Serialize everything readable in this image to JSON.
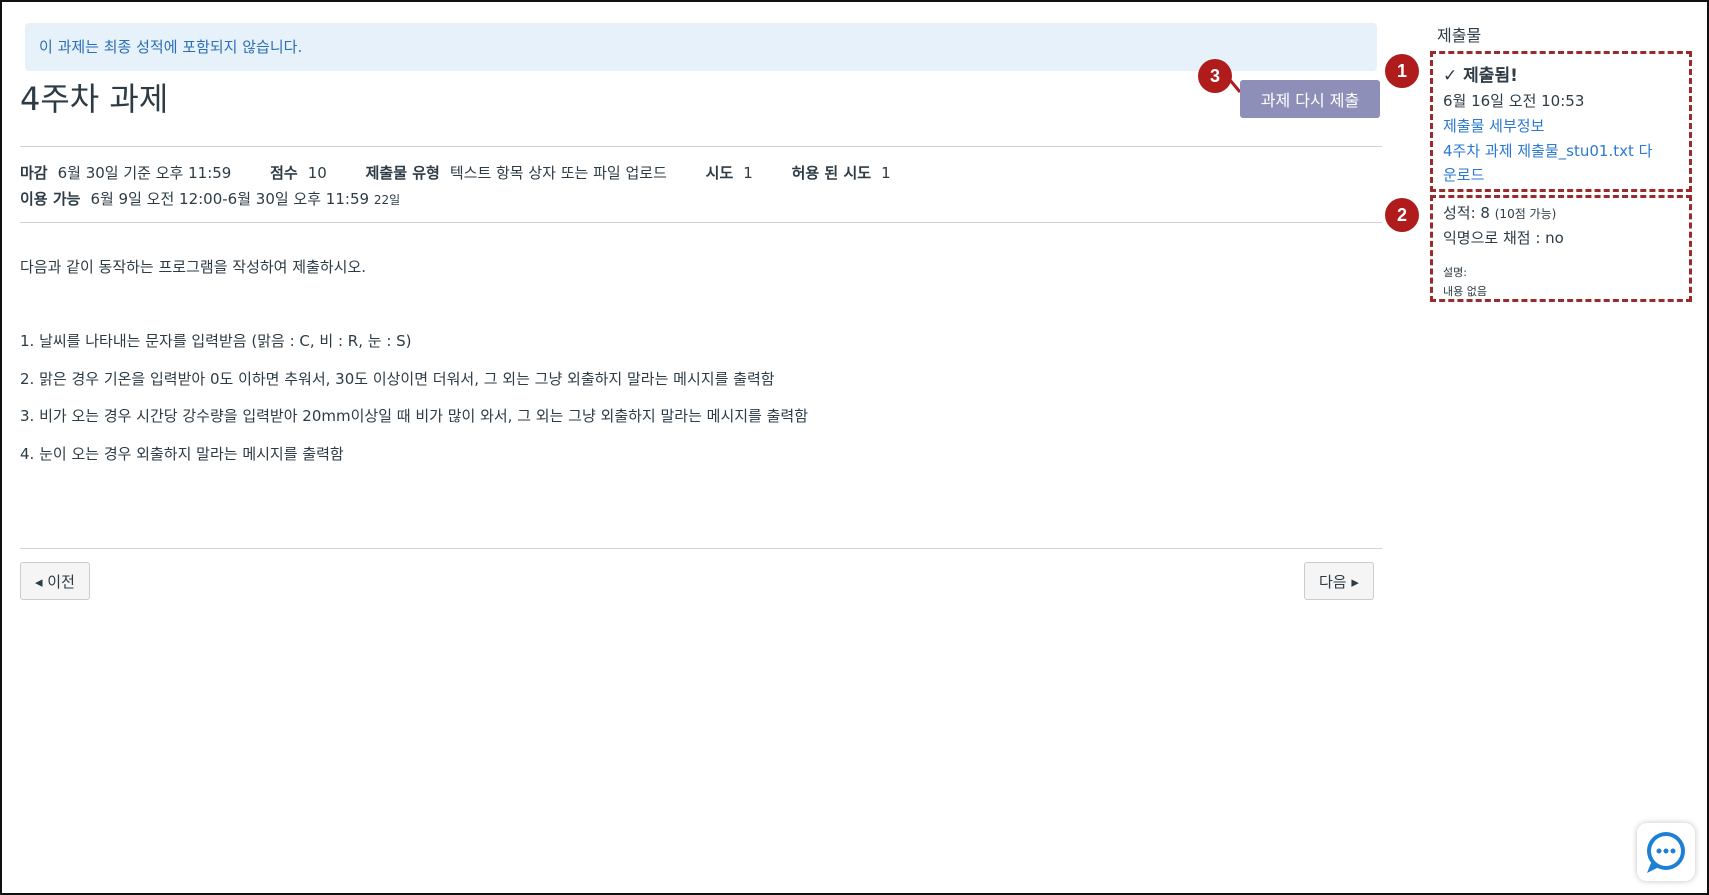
{
  "banner": "이 과제는 최종 성적에 포함되지 않습니다.",
  "assignment": {
    "title": "4주차 과제",
    "resubmit_label": "과제 다시 제출"
  },
  "callouts": [
    "1",
    "2",
    "3"
  ],
  "meta": {
    "due_label": "마감",
    "due_value": "6월 30일 기준 오후 11:59",
    "points_label": "점수",
    "points_value": "10",
    "submission_type_label": "제출물 유형",
    "submission_type_value": "텍스트 항목 상자 또는 파일 업로드",
    "attempts_label": "시도",
    "attempts_value": "1",
    "allowed_attempts_label": "허용 된 시도",
    "allowed_attempts_value": "1",
    "available_label": "이용 가능",
    "available_value": "6월 9일 오전 12:00-6월 30일 오후 11:59",
    "available_days": "22일"
  },
  "description": {
    "intro": "다음과 같이 동작하는 프로그램을 작성하여 제출하시오.",
    "items": [
      "1. 날씨를 나타내는 문자를 입력받음 (맑음 : C, 비 : R, 눈 : S)",
      "2. 맑은 경우 기온을 입력받아 0도 이하면 추워서, 30도 이상이면 더워서, 그 외는 그냥 외출하지 말라는 메시지를 출력함",
      "3. 비가 오는 경우 시간당 강수량을 입력받아 20mm이상일 때 비가 많이 와서, 그 외는 그냥 외출하지 말라는 메시지를 출력함",
      "4. 눈이 오는 경우 외출하지 말라는 메시지를 출력함"
    ]
  },
  "nav": {
    "prev_label": "◂ 이전",
    "next_label": "다음 ▸"
  },
  "sidebar": {
    "title": "제출물",
    "submitted_label": "제출됨!",
    "submitted_time": "6월 16일 오전 10:53",
    "details_link": "제출물 세부정보",
    "download_link_line1": "4주차 과제 제출물_stu01.txt 다",
    "download_link_line2": "운로드",
    "grade_label": "성적: 8",
    "grade_possible": "(10점 가능)",
    "anonymous_grading": "익명으로 채점 : no",
    "comments_label": "설명:",
    "comments_value": "내용 없음"
  },
  "colors": {
    "banner_bg": "#e6f1fa",
    "banner_text": "#2a6fb5",
    "button_bg": "#8d8fb8",
    "badge_red": "#b01b1b",
    "dash_border": "#9b2a2a",
    "link": "#2a79d4",
    "chat_blue": "#1e7fd6"
  }
}
